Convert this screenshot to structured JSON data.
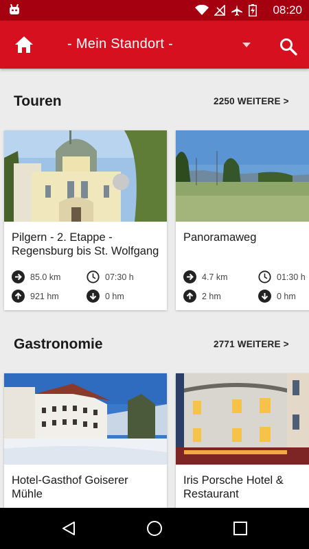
{
  "status_bar": {
    "time": "08:20",
    "icons": [
      "android-icon",
      "wifi-icon",
      "no-signal-icon",
      "airplane-icon",
      "battery-charging-icon"
    ]
  },
  "app_bar": {
    "location_label": "- Mein Standort -",
    "icons": [
      "home-icon",
      "dropdown-arrow-icon",
      "search-icon"
    ]
  },
  "sections": [
    {
      "title": "Touren",
      "more_label": "2250 WEITERE >",
      "cards": [
        {
          "title_line1": "Pilgern - 2. Etappe -",
          "title_line2": "Regensburg bis St. Wolfgang",
          "distance": "85.0 km",
          "duration": "07:30 h",
          "ascent": "921 hm",
          "descent": "0 hm",
          "image": "baroque-church-photo"
        },
        {
          "title_line1": "Panoramaweg",
          "title_line2": "",
          "distance": "4.7 km",
          "duration": "01:30 h",
          "ascent": "2 hm",
          "descent": "0 hm",
          "image": "meadow-landscape-photo"
        }
      ]
    },
    {
      "title": "Gastronomie",
      "more_label": "2771 WEITERE >",
      "cards": [
        {
          "title_line1": "Hotel-Gasthof Goiserer",
          "title_line2": "Mühle",
          "image": "snowy-hotel-photo"
        },
        {
          "title_line1": "Iris Porsche Hotel &",
          "title_line2": "Restaurant",
          "image": "hotel-facade-night-photo"
        }
      ]
    }
  ],
  "nav_bar": {
    "icons": [
      "back-icon",
      "home-circle-icon",
      "recents-icon"
    ]
  },
  "colors": {
    "status_bar": "#a4000f",
    "app_bar": "#d7101f",
    "background": "#ececec",
    "card": "#ffffff",
    "icon_dark": "#222222"
  }
}
